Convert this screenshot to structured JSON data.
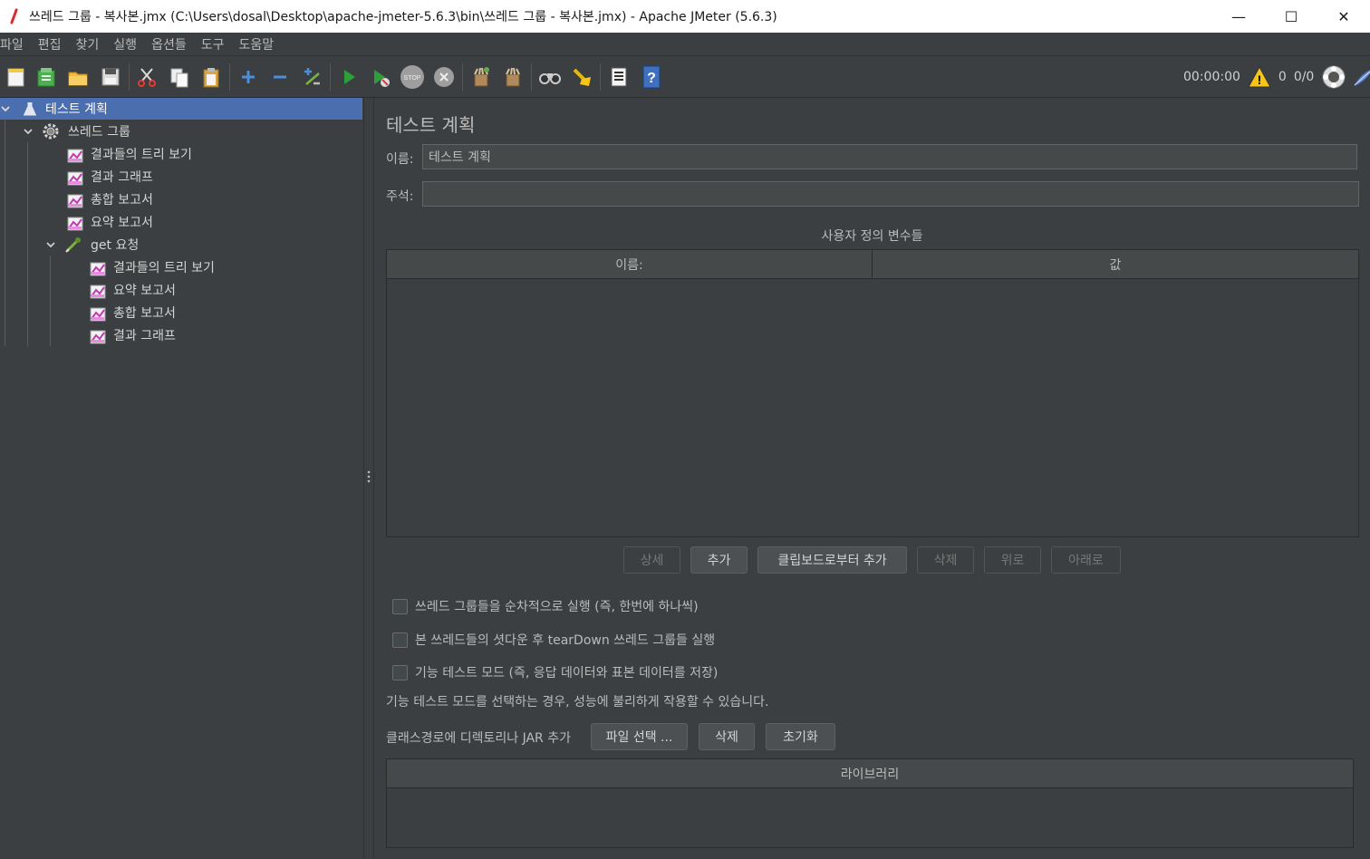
{
  "window": {
    "title": "쓰레드 그룹 - 복사본.jmx (C:\\Users\\dosal\\Desktop\\apache-jmeter-5.6.3\\bin\\쓰레드 그룹 - 복사본.jmx) - Apache JMeter (5.6.3)",
    "minimize": "—",
    "maximize": "☐",
    "close": "✕"
  },
  "menu": [
    "파일",
    "편집",
    "찾기",
    "실행",
    "옵션들",
    "도구",
    "도움말"
  ],
  "toolbar": {
    "buttons": [
      "new-icon",
      "templates-icon",
      "open-icon",
      "save-icon",
      "cut-icon",
      "copy-icon",
      "paste-icon",
      "expand-icon",
      "collapse-icon",
      "toggle-icon",
      "start-icon",
      "start-no-pause-icon",
      "stop-icon",
      "shutdown-icon",
      "clear-icon",
      "clear-all-icon",
      "search-icon",
      "reset-search-icon",
      "function-helper-icon",
      "help-icon"
    ],
    "timer": "00:00:00",
    "warnings": "0",
    "threads": "0/0"
  },
  "tree": {
    "root": "테스트 계획",
    "thread_group": "쓰레드 그룹",
    "tg_children": [
      "결과들의 트리 보기",
      "결과 그래프",
      "총합 보고서",
      "요약 보고서"
    ],
    "sampler": "get 요청",
    "sampler_children": [
      "결과들의 트리 보기",
      "요약 보고서",
      "총합 보고서",
      "결과 그래프"
    ]
  },
  "panel": {
    "title": "테스트 계획",
    "name_label": "이름:",
    "name_value": "테스트 계획",
    "comment_label": "주석:",
    "comment_value": "",
    "vars_title": "사용자 정의 변수들",
    "vars_columns": [
      "이름:",
      "값"
    ],
    "buttons": {
      "detail": "상세",
      "add": "추가",
      "add_clipboard": "클립보드로부터 추가",
      "delete": "삭제",
      "up": "위로",
      "down": "아래로"
    },
    "checkboxes": [
      "쓰레드 그룹들을 순차적으로 실행 (즉, 한번에 하나씩)",
      "본 쓰레드들의 셧다운 후 tearDown 쓰레드 그룹들 실행",
      "기능 테스트 모드 (즉, 응답 데이터와 표본 데이터를 저장)"
    ],
    "functional_note": "기능 테스트 모드를 선택하는 경우, 성능에 불리하게 작용할 수 있습니다.",
    "classpath_label": "클래스경로에 디렉토리나 JAR 추가",
    "classpath_buttons": {
      "browse": "파일 선택 ...",
      "delete": "삭제",
      "clear": "초기화"
    },
    "library_column": "라이브러리"
  }
}
